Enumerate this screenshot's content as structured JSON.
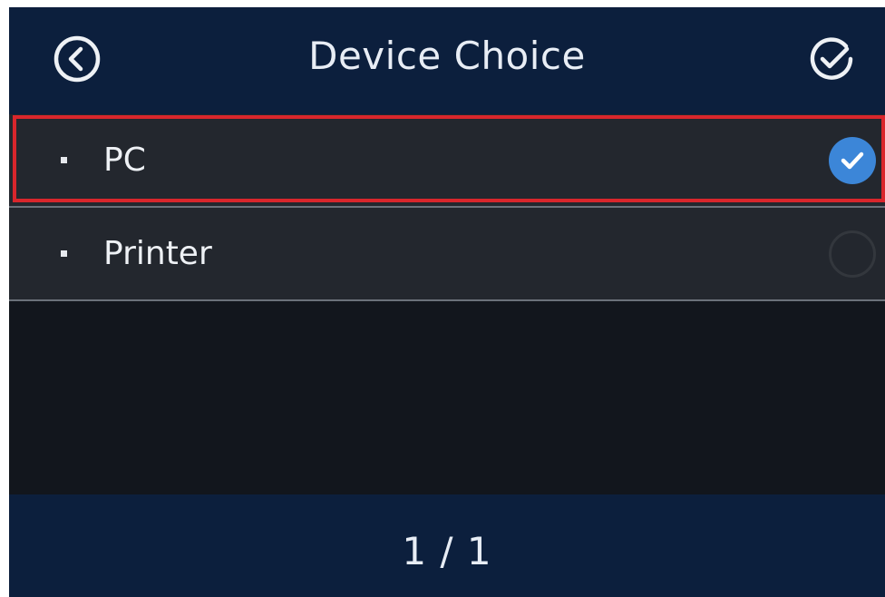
{
  "header": {
    "title": "Device Choice",
    "back_icon": "back-circle-icon",
    "confirm_icon": "check-circle-icon"
  },
  "list": {
    "items": [
      {
        "label": "PC",
        "selected": true
      },
      {
        "label": "Printer",
        "selected": false
      }
    ]
  },
  "footer": {
    "page_indicator": "1 / 1"
  },
  "colors": {
    "header_bg": "#0c1f3d",
    "row_bg": "#23272e",
    "body_bg": "#12161d",
    "selected_radio": "#3c86d8",
    "highlight_border": "#d9262c"
  }
}
